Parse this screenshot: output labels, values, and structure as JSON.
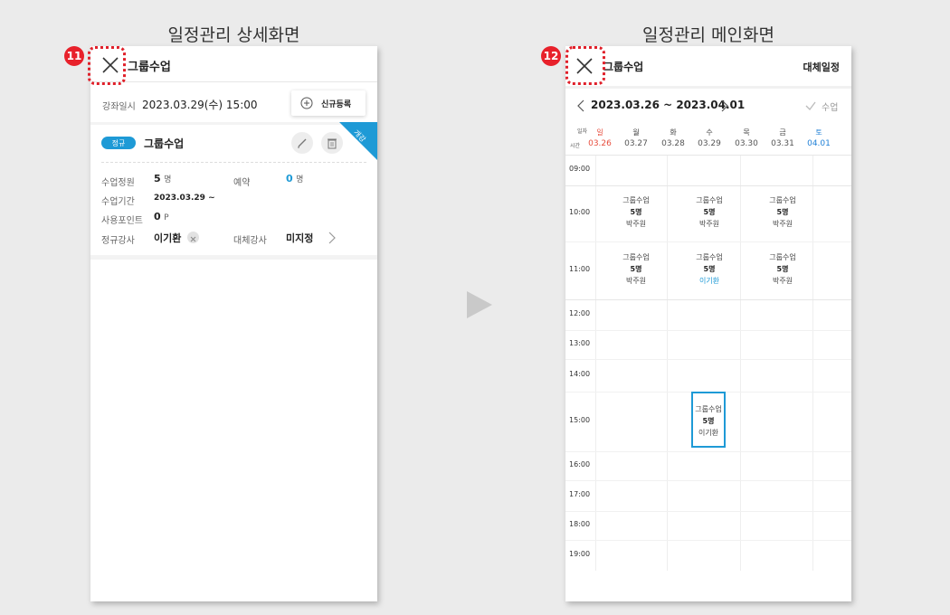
{
  "titles": {
    "left": "일정관리 상세화면",
    "right": "일정관리 메인화면"
  },
  "badges": {
    "left": "11",
    "right": "12"
  },
  "detail": {
    "header_title": "그룹수업",
    "lecture_label": "강좌일시",
    "lecture_datetime": "2023.03.29(수) 15:00",
    "new_register": "신규등록",
    "type_tag": "정규",
    "class_name": "그룹수업",
    "corner_tag": "개강",
    "capacity_label": "수업정원",
    "capacity_value": "5",
    "capacity_unit": "명",
    "reserve_label": "예약",
    "reserve_value": "0",
    "reserve_unit": "명",
    "period_label": "수업기간",
    "period_value": "2023.03.29 ~",
    "points_label": "사용포인트",
    "points_value": "0",
    "points_unit": "P",
    "teacher_label": "정규강사",
    "teacher_value": "이기환",
    "sub_label": "대체강사",
    "sub_value": "미지정"
  },
  "main": {
    "header_title": "그룹수업",
    "sub_schedule": "대체일정",
    "week_range": "2023.03.26 ~ 2023.04.01",
    "class_check": "수업",
    "corner_day": "일자",
    "corner_time": "시간",
    "days": [
      {
        "name": "일",
        "date": "03.26",
        "color": "#e74c3c"
      },
      {
        "name": "월",
        "date": "03.27",
        "color": "#444444"
      },
      {
        "name": "화",
        "date": "03.28",
        "color": "#444444"
      },
      {
        "name": "수",
        "date": "03.29",
        "color": "#444444"
      },
      {
        "name": "목",
        "date": "03.30",
        "color": "#444444"
      },
      {
        "name": "금",
        "date": "03.31",
        "color": "#444444"
      },
      {
        "name": "토",
        "date": "04.01",
        "color": "#1e7fd6"
      }
    ],
    "times": [
      "09:00",
      "10:00",
      "11:00",
      "12:00",
      "13:00",
      "14:00",
      "15:00",
      "16:00",
      "17:00",
      "18:00",
      "19:00"
    ],
    "events": [
      {
        "slot": "10:00",
        "day": "월",
        "name": "그룹수업",
        "count": "5명",
        "teacher": "박주원"
      },
      {
        "slot": "10:00",
        "day": "수",
        "name": "그룹수업",
        "count": "5명",
        "teacher": "박주원"
      },
      {
        "slot": "10:00",
        "day": "금",
        "name": "그룹수업",
        "count": "5명",
        "teacher": "박주원"
      },
      {
        "slot": "11:00",
        "day": "월",
        "name": "그룹수업",
        "count": "5명",
        "teacher": "박주원"
      },
      {
        "slot": "11:00",
        "day": "수",
        "name": "그룹수업",
        "count": "5명",
        "teacher": "이기환",
        "teacher_color": "#1e9ad6"
      },
      {
        "slot": "11:00",
        "day": "금",
        "name": "그룹수업",
        "count": "5명",
        "teacher": "박주원"
      },
      {
        "slot": "15:00",
        "day": "수",
        "name": "그룹수업",
        "count": "5명",
        "teacher": "이기환",
        "selected": true
      }
    ]
  },
  "colors": {
    "accent": "#1e9ad6",
    "badge": "#e8212b",
    "sunday": "#e74c3c",
    "saturday": "#1e7fd6"
  }
}
